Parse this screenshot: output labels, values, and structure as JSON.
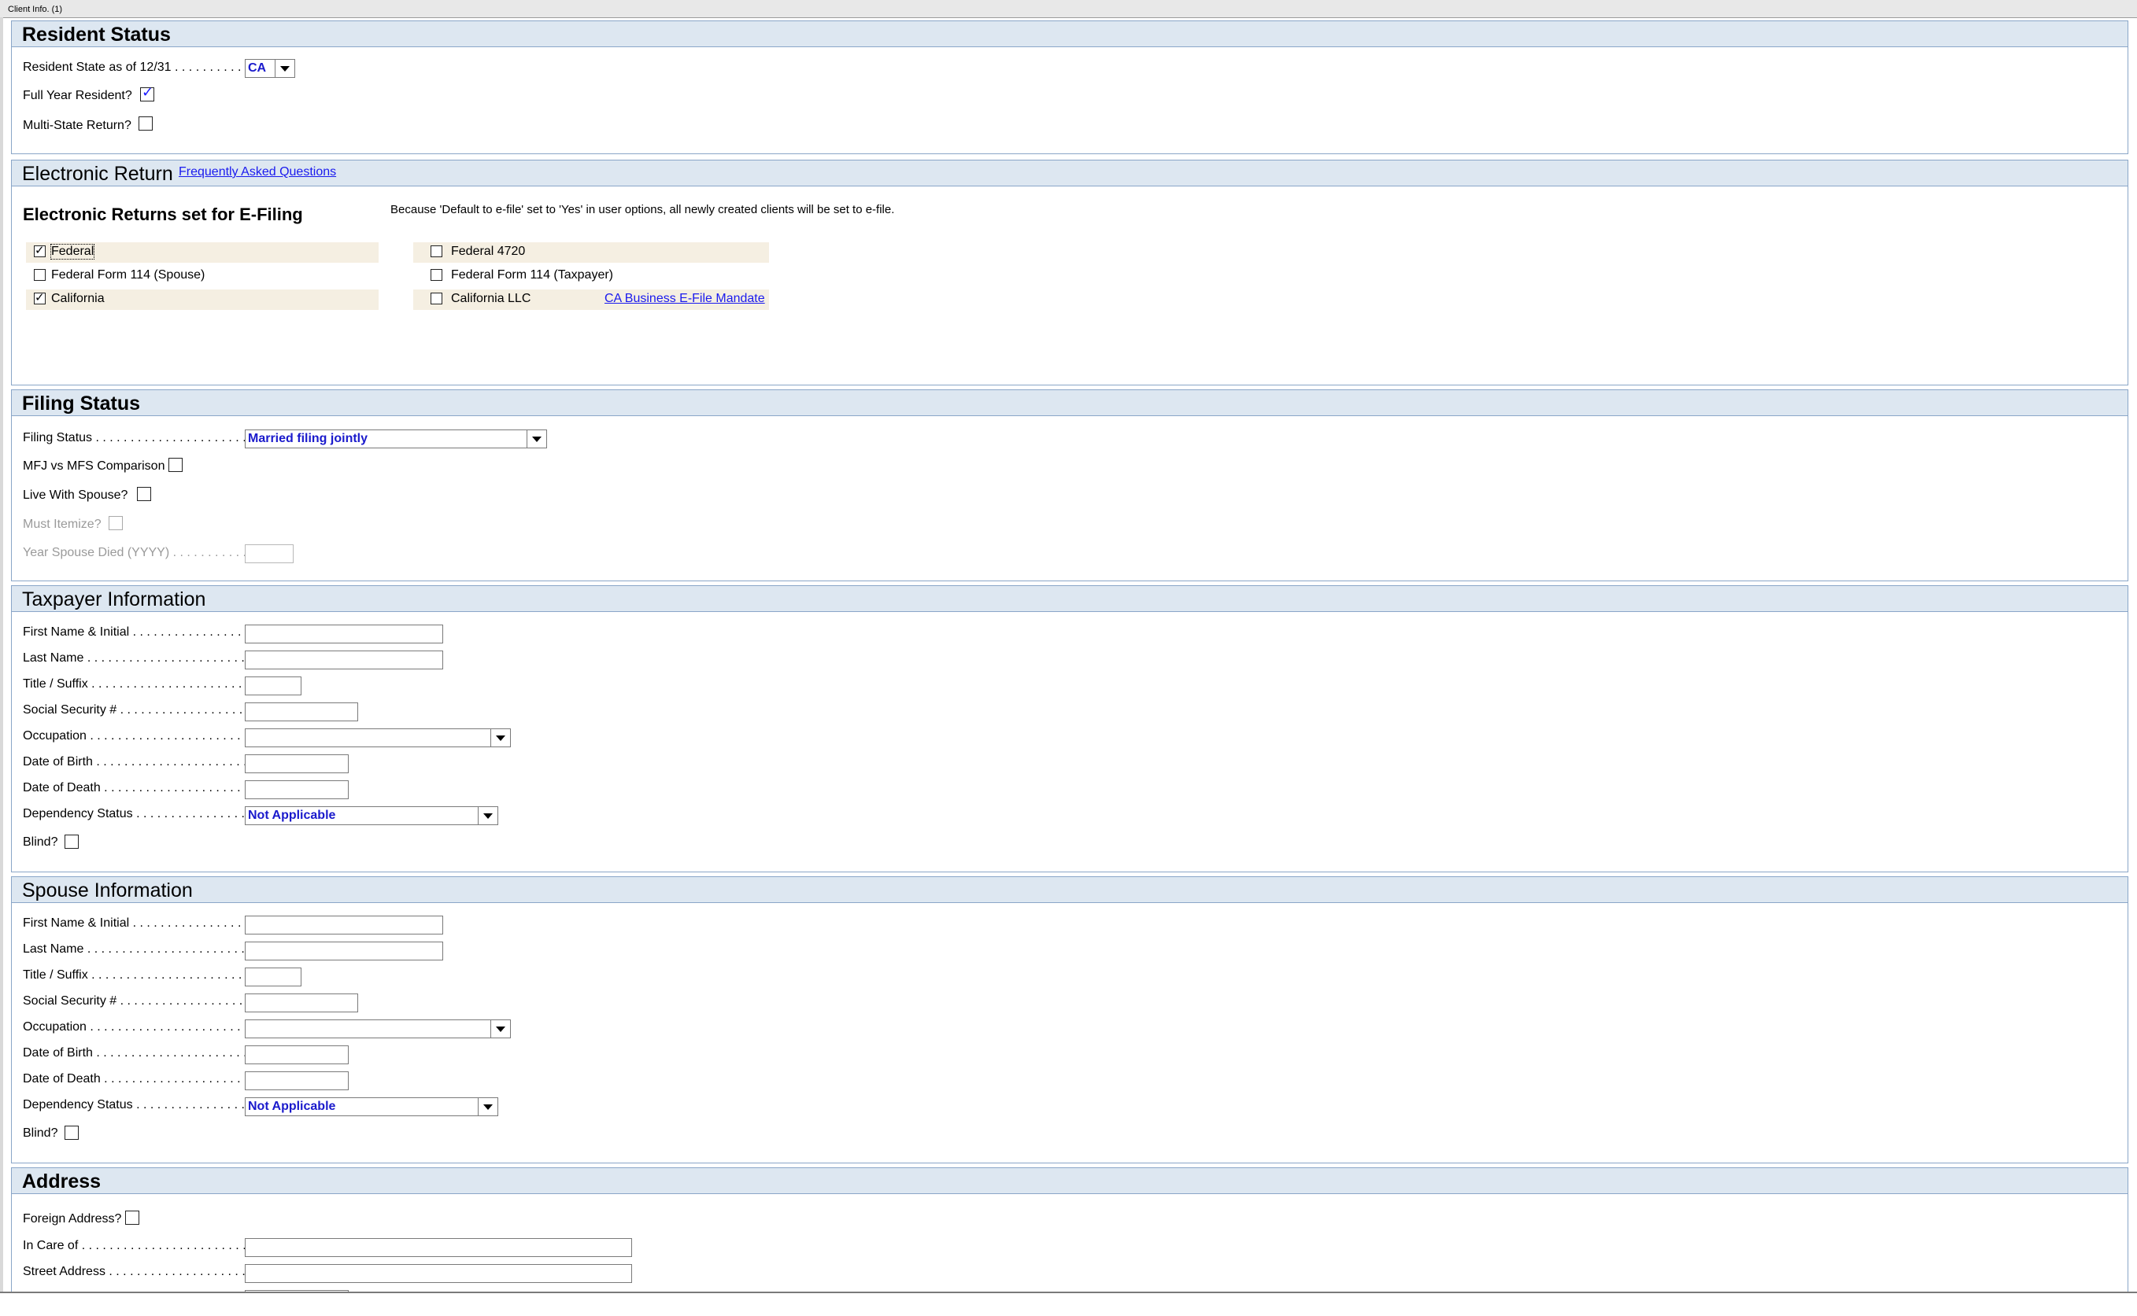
{
  "window": {
    "tab_title": "Client Info. (1)"
  },
  "resident_status": {
    "title": "Resident Status",
    "state_label": "Resident State as of 12/31",
    "state_value": "CA",
    "full_year_label": "Full Year Resident?",
    "full_year_checked": true,
    "multi_state_label": "Multi-State Return?",
    "multi_state_checked": false
  },
  "electronic_return": {
    "title": "Electronic Return",
    "faq_link": "Frequently Asked Questions",
    "subtitle": "Electronic Returns set for E-Filing",
    "note": "Because 'Default to e-file' set to 'Yes' in user options, all newly created clients will be set to e-file.",
    "left_items": [
      {
        "label": "Federal",
        "checked": true
      },
      {
        "label": "Federal Form 114 (Spouse)",
        "checked": false
      },
      {
        "label": "California",
        "checked": true
      }
    ],
    "right_items": [
      {
        "label": "Federal 4720",
        "checked": false
      },
      {
        "label": "Federal Form 114 (Taxpayer)",
        "checked": false
      },
      {
        "label": "California LLC",
        "checked": false
      }
    ],
    "mandate_link": "CA Business E-File Mandate"
  },
  "filing_status": {
    "title": "Filing Status",
    "status_label": "Filing Status",
    "status_value": "Married filing jointly",
    "mfj_label": "MFJ vs MFS Comparison",
    "live_label": "Live With Spouse?",
    "itemize_label": "Must Itemize?",
    "year_died_label": "Year Spouse Died (YYYY)"
  },
  "taxpayer": {
    "title": "Taxpayer Information",
    "first_name": "First Name & Initial",
    "last_name": "Last Name",
    "title_suffix": "Title / Suffix",
    "ssn": "Social Security #",
    "occupation": "Occupation",
    "dob": "Date of Birth",
    "dod": "Date of Death",
    "dependency": "Dependency Status",
    "dependency_value": "Not Applicable",
    "blind": "Blind?"
  },
  "spouse": {
    "title": "Spouse Information",
    "first_name": "First Name & Initial",
    "last_name": "Last Name",
    "title_suffix": "Title / Suffix",
    "ssn": "Social Security #",
    "occupation": "Occupation",
    "dob": "Date of Birth",
    "dod": "Date of Death",
    "dependency": "Dependency Status",
    "dependency_value": "Not Applicable",
    "blind": "Blind?"
  },
  "address": {
    "title": "Address",
    "foreign_label": "Foreign Address?",
    "in_care_label": "In Care of",
    "street_label": "Street Address"
  }
}
